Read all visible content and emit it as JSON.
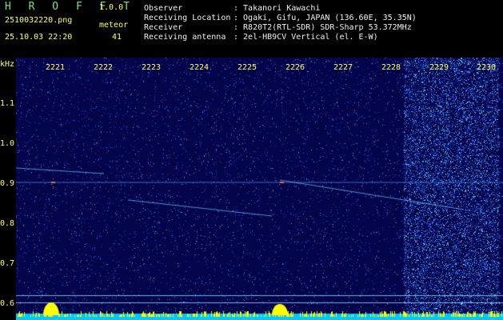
{
  "app": {
    "name": "H R O F F T",
    "version": "1.0.0"
  },
  "file": {
    "name": "2510032220.png",
    "datetime": "25.10.03 22:20"
  },
  "meteor": {
    "label": "meteor",
    "count": "41"
  },
  "info": [
    {
      "key": "Observer",
      "value": ": Takanori Kawachi"
    },
    {
      "key": "Receiving Location",
      "value": ": Ogaki, Gifu, JAPAN (136.60E, 35.35N)"
    },
    {
      "key": "Receiver",
      "value": ": R820T2(RTL-SDR) SDR-Sharp 53.372MHz"
    },
    {
      "key": "Receiving antenna",
      "value": ": 2el-HB9CV Vertical (el. E-W)"
    }
  ],
  "axis": {
    "y_unit": "kHz",
    "y_ticks": [
      "1.1",
      "1.0",
      "0.9",
      "0.8",
      "0.7",
      "0.6"
    ],
    "x_ticks": [
      "2221",
      "2222",
      "2223",
      "2224",
      "2225",
      "2226",
      "2227",
      "2228",
      "2229",
      "2230"
    ]
  },
  "colors": {
    "background": "#04044a",
    "text_green": "#7fe07f",
    "text_yellow": "#ffff66",
    "signal": "#ffff00",
    "noise": "#00c8ff"
  }
}
